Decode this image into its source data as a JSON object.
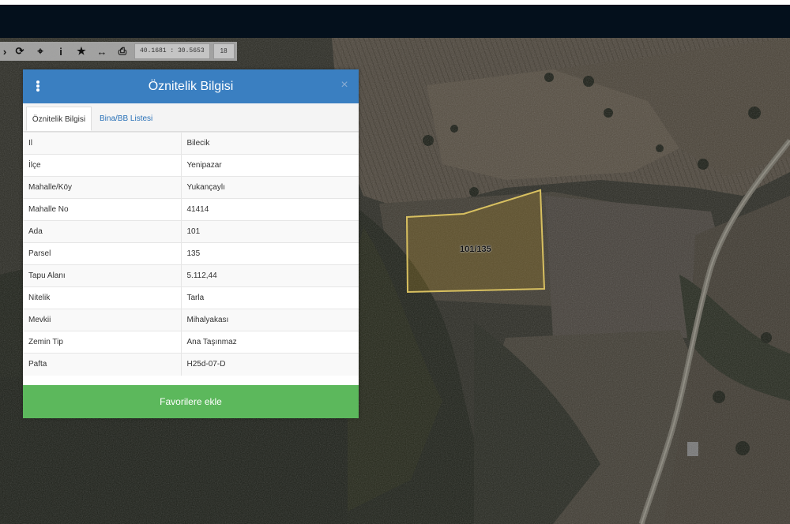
{
  "toolbar": {
    "coords": "40.1681 : 30.5653",
    "zoom": "18",
    "icons": [
      "refresh-icon",
      "crosshair-icon",
      "info-icon",
      "star-icon",
      "measure-icon",
      "print-icon"
    ],
    "glyphs": {
      "refresh": "⟳",
      "crosshair": "⌖",
      "info": "i",
      "star": "★",
      "measure": "↔",
      "print": "⎙"
    }
  },
  "panel": {
    "title": "Öznitelik Bilgisi",
    "close": "×",
    "tabs": [
      {
        "label": "Öznitelik Bilgisi",
        "active": true
      },
      {
        "label": "Bina/BB Listesi",
        "active": false
      }
    ],
    "rows": [
      {
        "key": "Il",
        "value": "Bilecik"
      },
      {
        "key": "İlçe",
        "value": "Yenipazar"
      },
      {
        "key": "Mahalle/Köy",
        "value": "Yukançaylı"
      },
      {
        "key": "Mahalle No",
        "value": "41414"
      },
      {
        "key": "Ada",
        "value": "101"
      },
      {
        "key": "Parsel",
        "value": "135"
      },
      {
        "key": "Tapu Alanı",
        "value": "5.112,44"
      },
      {
        "key": "Nitelik",
        "value": "Tarla"
      },
      {
        "key": "Mevkii",
        "value": "Mihalyakası"
      },
      {
        "key": "Zemin Tip",
        "value": "Ana Taşınmaz"
      },
      {
        "key": "Pafta",
        "value": "H25d-07-D"
      }
    ],
    "button": "Favorilere ekle"
  },
  "map": {
    "parcel_label": "101/135",
    "parcel_outline_color": "#d8c060"
  },
  "colors": {
    "header_bg": "#04101c",
    "panel_header": "#3a7fc1",
    "button_green": "#5cb85c",
    "tab_link": "#2a72b8"
  }
}
